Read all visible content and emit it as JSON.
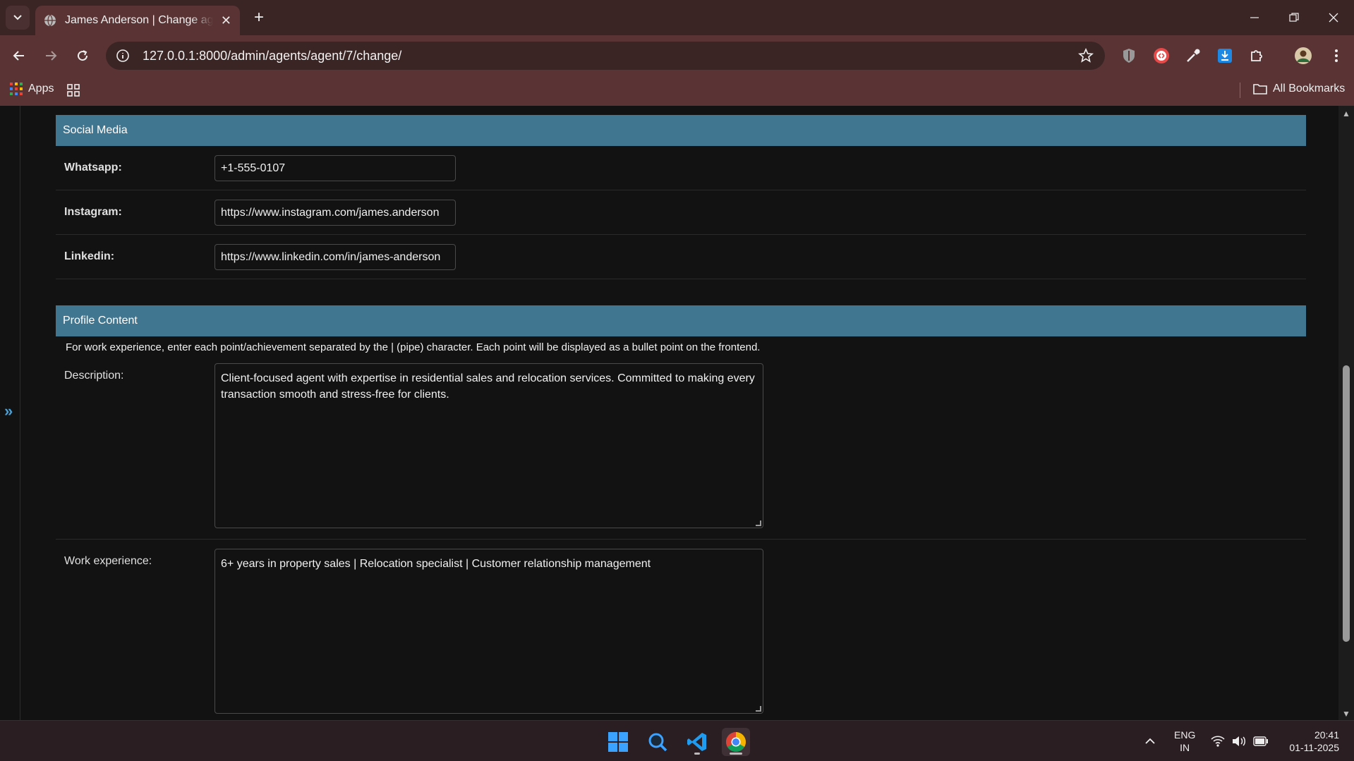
{
  "browser": {
    "tab_title": "James Anderson | Change agent",
    "url": "127.0.0.1:8000/admin/agents/agent/7/change/",
    "bookmarks": {
      "apps_label": "Apps",
      "all_bookmarks_label": "All Bookmarks"
    }
  },
  "social_media": {
    "header": "Social Media",
    "fields": [
      {
        "label": "Whatsapp:",
        "value": "+1-555-0107"
      },
      {
        "label": "Instagram:",
        "value": "https://www.instagram.com/james.anderson"
      },
      {
        "label": "Linkedin:",
        "value": "https://www.linkedin.com/in/james-anderson"
      }
    ]
  },
  "profile_content": {
    "header": "Profile Content",
    "help_text": "For work experience, enter each point/achievement separated by the | (pipe) character. Each point will be displayed as a bullet point on the frontend.",
    "description": {
      "label": "Description:",
      "value": "Client-focused agent with expertise in residential sales and relocation services. Committed to making every transaction smooth and stress-free for clients."
    },
    "work_experience": {
      "label": "Work experience:",
      "value": "6+ years in property sales | Relocation specialist | Customer relationship management"
    }
  },
  "sidebar": {
    "toggle_label": "»"
  },
  "taskbar": {
    "language": "ENG",
    "region": "IN",
    "time": "20:41",
    "date": "01-11-2025"
  },
  "colors": {
    "module_header": "#417690",
    "page_background": "#121212",
    "browser_frame": "#3b2424",
    "toolbar": "#5a3434"
  },
  "icons": [
    "globe-icon",
    "close-icon",
    "new-tab-icon",
    "back-icon",
    "forward-icon",
    "reload-icon",
    "site-info-icon",
    "star-icon",
    "shield-extension-icon",
    "extension-icon",
    "eyedropper-icon",
    "download-icon",
    "puzzle-icon",
    "profile-avatar",
    "menu-icon",
    "apps-icon",
    "folder-icon",
    "windows-start-icon",
    "search-icon",
    "vscode-icon",
    "chrome-icon",
    "wifi-icon",
    "volume-icon",
    "battery-icon"
  ]
}
